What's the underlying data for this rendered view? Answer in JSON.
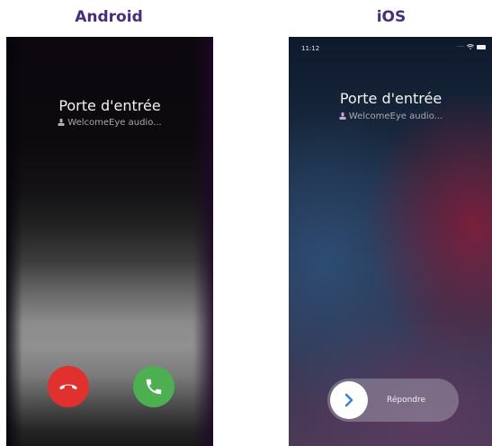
{
  "headings": {
    "android": "Android",
    "ios": "iOS"
  },
  "android": {
    "caller_name": "Porte d'entrée",
    "caller_app": "WelcomeEye audio...",
    "decline_icon": "phone-hangup-icon",
    "accept_icon": "phone-answer-icon",
    "colors": {
      "decline": "#e0312e",
      "accept": "#4caf50"
    }
  },
  "ios": {
    "status_time": "11:12",
    "caller_name": "Porte d'entrée",
    "caller_app": "WelcomeEye audio...",
    "slider_label": "Répondre",
    "slider_icon": "chevron-right-icon",
    "colors": {
      "chevron": "#3a82d6"
    }
  },
  "colors": {
    "heading": "#4a2d7a"
  }
}
